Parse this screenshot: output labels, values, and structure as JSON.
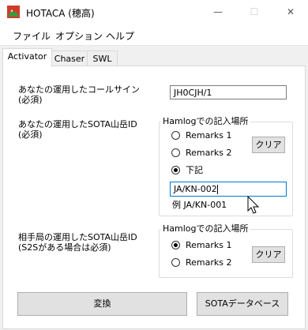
{
  "window": {
    "title": "HOTACA (穂高)",
    "icon": "hotaca-app-icon",
    "controls": {
      "minimize": "—",
      "maximize": "☐",
      "close": "✕"
    }
  },
  "menu": {
    "items": [
      "ファイル",
      "オプション",
      "ヘルプ"
    ]
  },
  "tabs": [
    "Activator",
    "Chaser",
    "SWL"
  ],
  "activator": {
    "callsign_label_line1": "あなたの運用したコールサイン",
    "callsign_label_line2": "(必須)",
    "callsign_value": "JH0CJH/1",
    "sota_label_line1": "あなたの運用したSOTA山岳ID",
    "sota_label_line2": "(必須)",
    "group1": {
      "title": "Hamlogでの記入場所",
      "radio1": "Remarks 1",
      "radio2": "Remarks 2",
      "radio3": "下記",
      "clear_button": "クリア",
      "summit_value": "JA/KN-002",
      "example": "例 JA/KN-001"
    },
    "s2s_label_line1": "相手局の運用したSOTA山岳ID",
    "s2s_label_line2": "(S2Sがある場合は必須)",
    "group2": {
      "title": "Hamlogでの記入場所",
      "radio1": "Remarks 1",
      "radio2": "Remarks 2",
      "clear_button": "クリア"
    },
    "convert_button": "変換",
    "database_button": "SOTAデータベース"
  },
  "colors": {
    "focus_border": "#0078d7",
    "button_bg": "#e1e1e1"
  }
}
